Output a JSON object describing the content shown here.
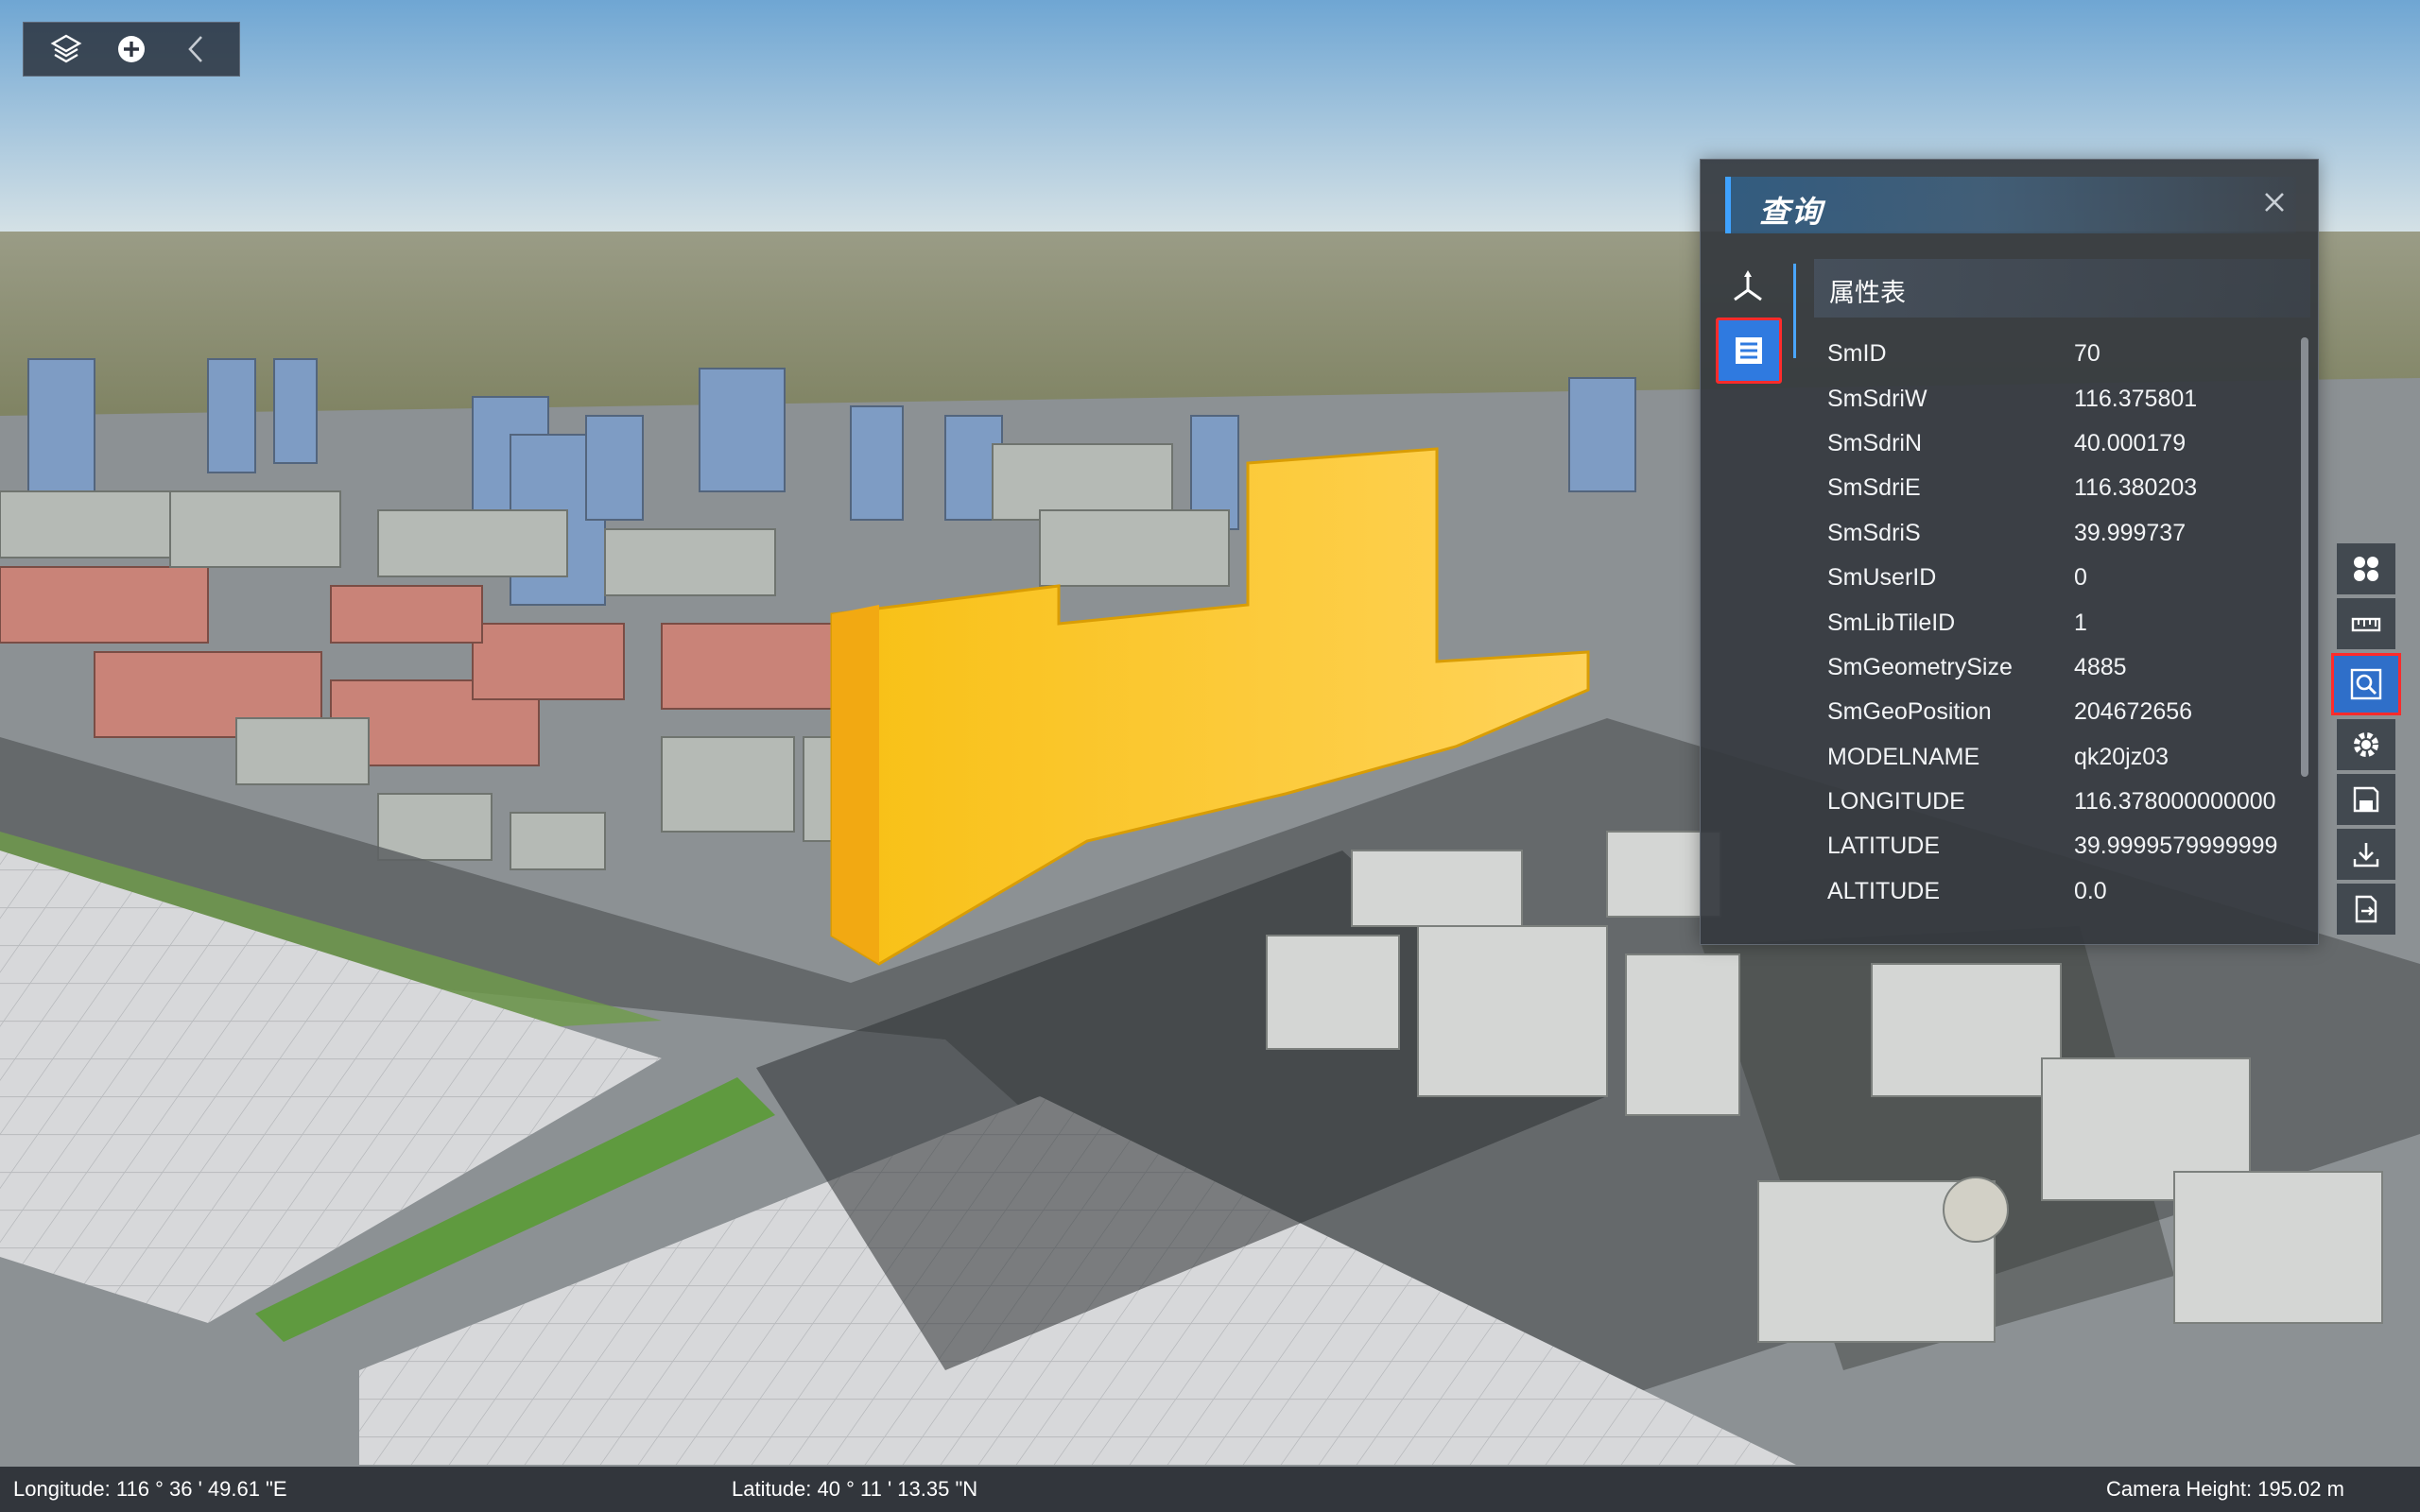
{
  "toolbar": {
    "layers_icon": "layers-icon",
    "add_icon": "plus-circle-icon",
    "collapse_icon": "chevron-left-icon"
  },
  "query_panel": {
    "title": "查询",
    "close_icon": "close-icon",
    "side_tabs": [
      {
        "icon": "axis-icon"
      },
      {
        "icon": "list-icon",
        "selected": true
      }
    ],
    "attribute_table_title": "属性表",
    "attributes": [
      {
        "key": "SmID",
        "value": "70"
      },
      {
        "key": "SmSdriW",
        "value": "116.375801"
      },
      {
        "key": "SmSdriN",
        "value": "40.000179"
      },
      {
        "key": "SmSdriE",
        "value": "116.380203"
      },
      {
        "key": "SmSdriS",
        "value": "39.999737"
      },
      {
        "key": "SmUserID",
        "value": "0"
      },
      {
        "key": "SmLibTileID",
        "value": "1"
      },
      {
        "key": "SmGeometrySize",
        "value": "4885"
      },
      {
        "key": "SmGeoPosition",
        "value": "204672656"
      },
      {
        "key": "MODELNAME",
        "value": "qk20jz03"
      },
      {
        "key": "LONGITUDE",
        "value": "116.378000000000"
      },
      {
        "key": "LATITUDE",
        "value": "39.9999579999999"
      },
      {
        "key": "ALTITUDE",
        "value": "0.0"
      }
    ]
  },
  "right_toolbar": {
    "icons": [
      "apps-icon",
      "ruler-icon",
      "query-icon",
      "gear-icon",
      "save-icon",
      "download-icon",
      "export-icon"
    ],
    "active": "query-icon"
  },
  "status_bar": {
    "longitude_label": "Longitude:",
    "longitude_value": "116 ° 36 ' 49.61 \"E",
    "latitude_label": "Latitude:",
    "latitude_value": "40 ° 11 ' 13.35 \"N",
    "camera_height_label": "Camera Height:",
    "camera_height_value": "195.02 m"
  },
  "colors": {
    "highlight_building": "#ffc21a",
    "accent_blue": "#2f7ae0",
    "selection_outline": "#ff2b2b"
  }
}
